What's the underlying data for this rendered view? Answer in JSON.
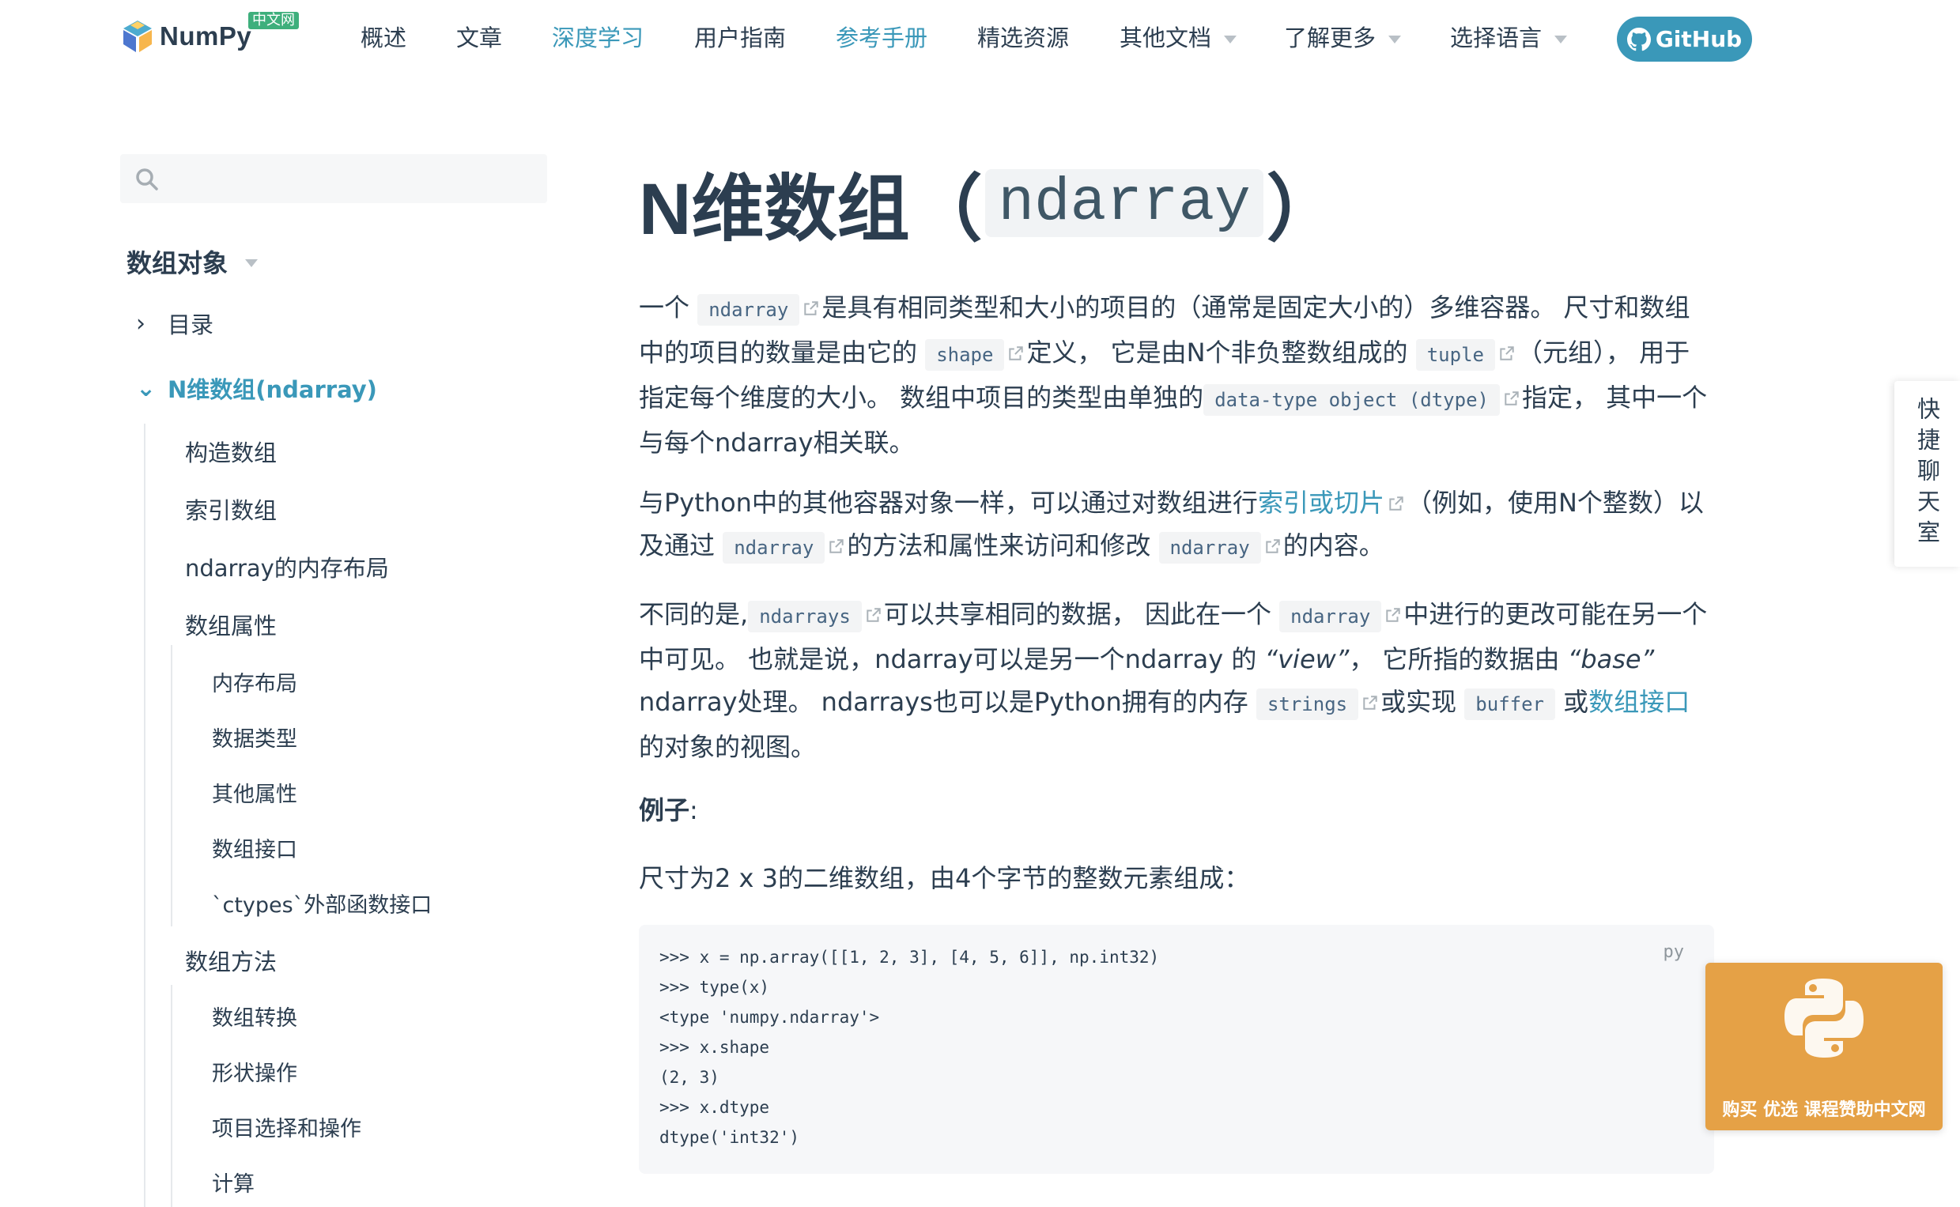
{
  "brand": {
    "name": "NumPy",
    "badge": "中文网"
  },
  "nav": {
    "items": [
      {
        "label": "概述"
      },
      {
        "label": "文章"
      },
      {
        "label": "深度学习"
      },
      {
        "label": "用户指南"
      },
      {
        "label": "参考手册"
      },
      {
        "label": "精选资源"
      },
      {
        "label": "其他文档"
      },
      {
        "label": "了解更多"
      },
      {
        "label": "选择语言"
      }
    ],
    "github_label": "GitHub",
    "accent_color": "#3a98b9"
  },
  "search": {
    "placeholder": ""
  },
  "sidebar": {
    "group_title": "数组对象",
    "toc": [
      {
        "label": "目录"
      },
      {
        "label": "N维数组(ndarray)"
      }
    ],
    "items": [
      {
        "label": "构造数组"
      },
      {
        "label": "索引数组"
      },
      {
        "label": "ndarray的内存布局"
      },
      {
        "label": "数组属性"
      },
      {
        "label": "内存布局"
      },
      {
        "label": "数据类型"
      },
      {
        "label": "其他属性"
      },
      {
        "label": "数组接口"
      },
      {
        "label": "`ctypes`外部函数接口"
      },
      {
        "label": "数组方法"
      },
      {
        "label": "数组转换"
      },
      {
        "label": "形状操作"
      },
      {
        "label": "项目选择和操作"
      },
      {
        "label": "计算"
      }
    ]
  },
  "main": {
    "title_prefix": "N维数组（",
    "title_code": "ndarray",
    "title_suffix": "）",
    "p1": {
      "t1": "一个",
      "c1": "ndarray",
      "t2": "是具有相同类型和大小的项目的（通常是固定大小的）多维容器。 尺寸和数组中的项目的数量是由它的",
      "c2": "shape",
      "t3": "定义， 它是由N个非负整数组成的",
      "c3": "tuple",
      "t4": "（元组）， 用于指定每个维度的大小。 数组中项目的类型由单独的",
      "c4": "data-type object (dtype)",
      "t5": "指定， 其中一个与每个ndarray相关联。"
    },
    "p2": {
      "t1": "与Python中的其他容器对象一样，可以通过对数组进行",
      "link1": "索引或切片",
      "t2": "（例如，使用N个整数）以及通过",
      "c1": "ndarray",
      "t3": "的方法和属性来访问和修改",
      "c2": "ndarray",
      "t4": "的内容。"
    },
    "p3": {
      "t1": "不同的是,",
      "c1": "ndarrays",
      "t2": "可以共享相同的数据， 因此在一个",
      "c2": "ndarray",
      "t3": "中进行的更改可能在另一个中可见。 也就是说，ndarray可以是另一个ndarray 的",
      "em1": "“view”",
      "t4": "， 它所指的数据由",
      "em2": "“base”",
      "t5": "ndarray处理。 ndarrays也可以是Python拥有的内存",
      "c3": "strings",
      "t6": "或实现",
      "c4": "buffer",
      "t7": "或",
      "link1": "数组接口",
      "t8": "的对象的视图。"
    },
    "example_label": "例子",
    "example_colon": ":",
    "example_desc": "尺寸为2 x 3的二维数组，由4个字节的整数元素组成："
  },
  "code": {
    "lang": "py",
    "lines": [
      ">>> x = np.array([[1, 2, 3], [4, 5, 6]], np.int32)",
      ">>> type(x)",
      "<type 'numpy.ndarray'>",
      ">>> x.shape",
      "(2, 3)",
      ">>> x.dtype",
      "dtype('int32')"
    ]
  },
  "chat_tab": {
    "label": "快捷聊天室"
  },
  "ad": {
    "text": "购买 优选 课程赞助中文网",
    "color": "#e5a146"
  }
}
